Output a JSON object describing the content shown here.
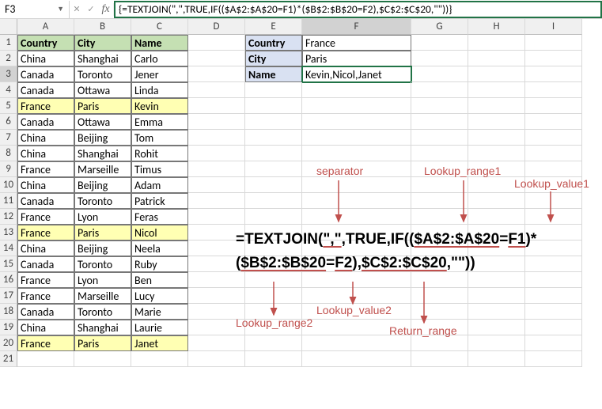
{
  "namebox": "F3",
  "formula": "{=TEXTJOIN(\",\",TRUE,IF(($A$2:$A$20=F1)*($B$2:$B$20=F2),$C$2:$C$20,\"\"))}",
  "cols": [
    "A",
    "B",
    "C",
    "D",
    "E",
    "F",
    "G",
    "H",
    "I"
  ],
  "rows": [
    "1",
    "2",
    "3",
    "4",
    "5",
    "6",
    "7",
    "8",
    "9",
    "10",
    "11",
    "12",
    "13",
    "14",
    "15",
    "16",
    "17",
    "18",
    "19",
    "20",
    "21"
  ],
  "headers": {
    "A": "Country",
    "B": "City",
    "C": "Name"
  },
  "table": [
    {
      "A": "China",
      "B": "Shanghai",
      "C": "Carlo"
    },
    {
      "A": "Canada",
      "B": "Toronto",
      "C": "Jener"
    },
    {
      "A": "Canada",
      "B": "Ottawa",
      "C": "Linda"
    },
    {
      "A": "France",
      "B": "Paris",
      "C": "Kevin",
      "hl": true
    },
    {
      "A": "Canada",
      "B": "Ottawa",
      "C": "Emma"
    },
    {
      "A": "China",
      "B": "Beijing",
      "C": "Tom"
    },
    {
      "A": "China",
      "B": "Shanghai",
      "C": "Rohit"
    },
    {
      "A": "France",
      "B": "Marseille",
      "C": "Timus"
    },
    {
      "A": "China",
      "B": "Beijing",
      "C": "Adam"
    },
    {
      "A": "Canada",
      "B": "Toronto",
      "C": "Patrick"
    },
    {
      "A": "France",
      "B": "Lyon",
      "C": "Feras"
    },
    {
      "A": "France",
      "B": "Paris",
      "C": "Nicol",
      "hl": true
    },
    {
      "A": "China",
      "B": "Beijing",
      "C": "Neela"
    },
    {
      "A": "Canada",
      "B": "Toronto",
      "C": "Ruby"
    },
    {
      "A": "France",
      "B": "Lyon",
      "C": "Ben"
    },
    {
      "A": "France",
      "B": "Marseille",
      "C": "Lucy"
    },
    {
      "A": "Canada",
      "B": "Toronto",
      "C": "Marie"
    },
    {
      "A": "China",
      "B": "Shanghai",
      "C": "Laurie"
    },
    {
      "A": "France",
      "B": "Paris",
      "C": "Janet",
      "hl": true
    }
  ],
  "lookup": {
    "E1": "Country",
    "F1": "France",
    "E2": "City",
    "F2": "Paris",
    "E3": "Name",
    "F3": "Kevin,Nicol,Janet"
  },
  "anno": {
    "line1_pre": "=TEXTJOIN(",
    "sep": "\",\"",
    "mid1": ",TRUE,IF((",
    "lr1": "$A$2:$A$20",
    "eq1": "=",
    "lv1": "F1",
    "mid2": ")*",
    "line2_open": "(",
    "lr2": "$B$2:$B$20",
    "eq2": "=",
    "lv2": "F2",
    "mid3": "),",
    "rr": "$C$2:$C$20",
    "tail": ",\"\"))",
    "l_sep": "separator",
    "l_lr1": "Lookup_range1",
    "l_lv1": "Lookup_value1",
    "l_lr2": "Lookup_range2",
    "l_lv2": "Lookup_value2",
    "l_rr": "Return_range"
  },
  "chart_data": {
    "type": "table",
    "title": "Multi-criteria TEXTJOIN lookup example",
    "input_columns": [
      "Country",
      "City",
      "Name"
    ],
    "input_rows": [
      [
        "China",
        "Shanghai",
        "Carlo"
      ],
      [
        "Canada",
        "Toronto",
        "Jener"
      ],
      [
        "Canada",
        "Ottawa",
        "Linda"
      ],
      [
        "France",
        "Paris",
        "Kevin"
      ],
      [
        "Canada",
        "Ottawa",
        "Emma"
      ],
      [
        "China",
        "Beijing",
        "Tom"
      ],
      [
        "China",
        "Shanghai",
        "Rohit"
      ],
      [
        "France",
        "Marseille",
        "Timus"
      ],
      [
        "China",
        "Beijing",
        "Adam"
      ],
      [
        "Canada",
        "Toronto",
        "Patrick"
      ],
      [
        "France",
        "Lyon",
        "Feras"
      ],
      [
        "France",
        "Paris",
        "Nicol"
      ],
      [
        "China",
        "Beijing",
        "Neela"
      ],
      [
        "Canada",
        "Toronto",
        "Ruby"
      ],
      [
        "France",
        "Lyon",
        "Ben"
      ],
      [
        "France",
        "Marseille",
        "Lucy"
      ],
      [
        "Canada",
        "Toronto",
        "Marie"
      ],
      [
        "China",
        "Shanghai",
        "Laurie"
      ],
      [
        "France",
        "Paris",
        "Janet"
      ]
    ],
    "criteria": {
      "Country": "France",
      "City": "Paris"
    },
    "result": "Kevin,Nicol,Janet",
    "formula": "{=TEXTJOIN(\",\",TRUE,IF(($A$2:$A$20=F1)*($B$2:$B$20=F2),$C$2:$C$20,\"\"))}"
  }
}
